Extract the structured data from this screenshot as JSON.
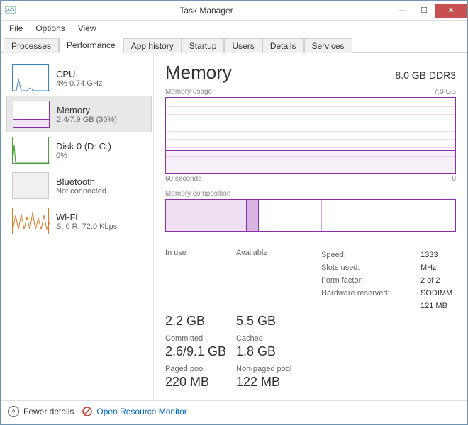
{
  "window": {
    "title": "Task Manager"
  },
  "menu": {
    "file": "File",
    "options": "Options",
    "view": "View"
  },
  "tabs": {
    "processes": "Processes",
    "performance": "Performance",
    "app_history": "App history",
    "startup": "Startup",
    "users": "Users",
    "details": "Details",
    "services": "Services"
  },
  "sidebar": {
    "cpu": {
      "title": "CPU",
      "sub": "4% 0.74 GHz"
    },
    "memory": {
      "title": "Memory",
      "sub": "2.4/7.9 GB (30%)"
    },
    "disk": {
      "title": "Disk 0 (D: C:)",
      "sub": "0%"
    },
    "bluetooth": {
      "title": "Bluetooth",
      "sub": "Not connected"
    },
    "wifi": {
      "title": "Wi-Fi",
      "sub": "S: 0 R: 72.0 Kbps"
    }
  },
  "main": {
    "title": "Memory",
    "capacity": "8.0 GB DDR3",
    "usage_label": "Memory usage",
    "usage_max": "7.9 GB",
    "axis_left": "60 seconds",
    "axis_right": "0",
    "comp_label": "Memory composition",
    "stats": {
      "in_use_label": "In use",
      "in_use": "2.2 GB",
      "available_label": "Available",
      "available": "5.5 GB",
      "committed_label": "Committed",
      "committed": "2.6/9.1 GB",
      "cached_label": "Cached",
      "cached": "1.8 GB",
      "paged_label": "Paged pool",
      "paged": "220 MB",
      "nonpaged_label": "Non-paged pool",
      "nonpaged": "122 MB"
    },
    "kv": {
      "speed_label": "Speed:",
      "speed": "1333 MHz",
      "slots_label": "Slots used:",
      "slots": "2 of 2",
      "form_label": "Form factor:",
      "form": "SODIMM",
      "hw_label": "Hardware reserved:",
      "hw": "121 MB"
    }
  },
  "footer": {
    "fewer": "Fewer details",
    "orm": "Open Resource Monitor"
  },
  "chart_data": {
    "type": "line",
    "title": "Memory usage",
    "xlabel": "60 seconds → 0",
    "ylabel": "GB",
    "ylim": [
      0,
      7.9
    ],
    "x": [
      60,
      0
    ],
    "series": [
      {
        "name": "In use",
        "values": [
          2.4,
          2.4
        ]
      }
    ],
    "composition": {
      "in_use_gb": 2.2,
      "modified_gb": 0.3,
      "standby_gb": 1.8,
      "free_gb": 3.6,
      "total_gb": 7.9
    }
  }
}
